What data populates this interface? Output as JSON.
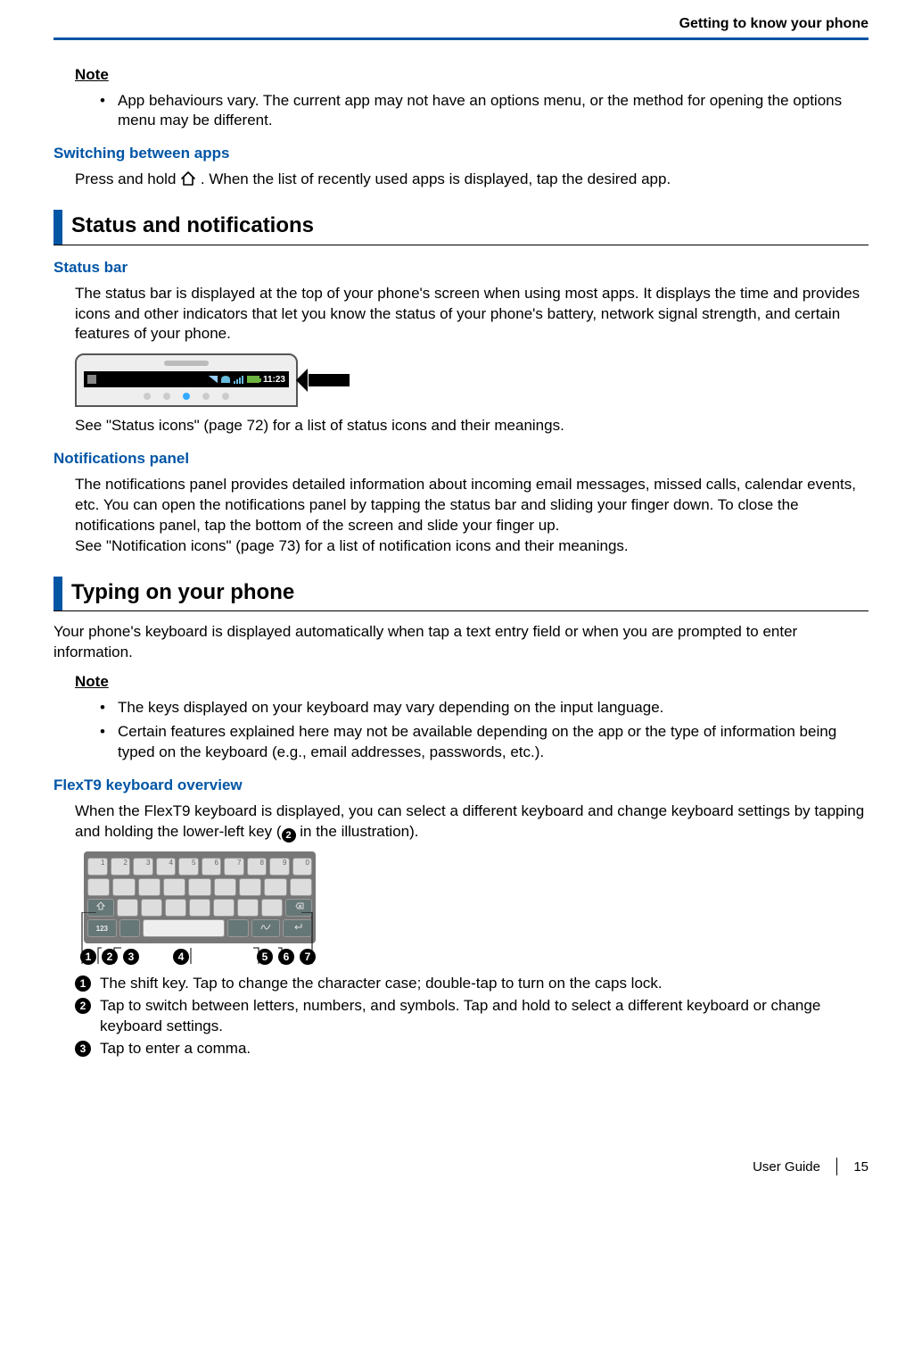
{
  "running_head": "Getting to know your phone",
  "note1": {
    "label": "Note",
    "items": [
      "App behaviours vary. The current app may not have an options menu, or the method for opening the options menu may be different."
    ]
  },
  "switching": {
    "heading": "Switching between apps",
    "text_before": "Press and hold ",
    "text_after": ". When the list of recently used apps is displayed, tap the desired app."
  },
  "status_section": {
    "title": "Status and notifications",
    "status_bar": {
      "heading": "Status bar",
      "para": "The status bar is displayed at the top of your phone's screen when using most apps. It displays the time and provides icons and other indicators that let you know the status of your phone's battery, network signal strength, and certain features of your phone.",
      "time": "11:23",
      "see": "See \"Status icons\" (page 72) for a list of status icons and their meanings."
    },
    "notifications": {
      "heading": "Notifications panel",
      "para1": "The notifications panel provides detailed information about incoming email messages, missed calls, calendar events, etc. You can open the notifications panel by tapping the status bar and sliding your finger down. To close the notifications panel, tap the bottom of the screen and slide your finger up.",
      "para2": "See \"Notification icons\" (page 73) for a list of notification icons and their meanings."
    }
  },
  "typing_section": {
    "title": "Typing on your phone",
    "intro": "Your phone's keyboard is displayed automatically when tap a text entry field or when you are prompted to enter information.",
    "note": {
      "label": "Note",
      "items": [
        "The keys displayed on your keyboard may vary depending on the input language.",
        "Certain features explained here may not be available depending on the app or the type of information being typed on the keyboard (e.g., email addresses, passwords, etc.)."
      ]
    },
    "flex": {
      "heading": "FlexT9 keyboard overview",
      "para_before": "When the FlexT9 keyboard is displayed, you can select a different keyboard and change keyboard settings by tapping and holding the lower-left key (",
      "para_after": " in the illustration).",
      "key123": "123",
      "numrow": [
        "1",
        "2",
        "3",
        "4",
        "5",
        "6",
        "7",
        "8",
        "9",
        "0"
      ],
      "callouts": {
        "c1": "1",
        "c2": "2",
        "c3": "3",
        "c4": "4",
        "c5": "5",
        "c6": "6",
        "c7": "7"
      },
      "descs": [
        {
          "n": "1",
          "t": "The shift key. Tap to change the character case; double-tap to turn on the caps lock."
        },
        {
          "n": "2",
          "t": "Tap to switch between letters, numbers, and symbols. Tap and hold to select a different keyboard or change keyboard settings."
        },
        {
          "n": "3",
          "t": "Tap to enter a comma."
        }
      ]
    }
  },
  "footer": {
    "guide": "User Guide",
    "page": "15"
  }
}
